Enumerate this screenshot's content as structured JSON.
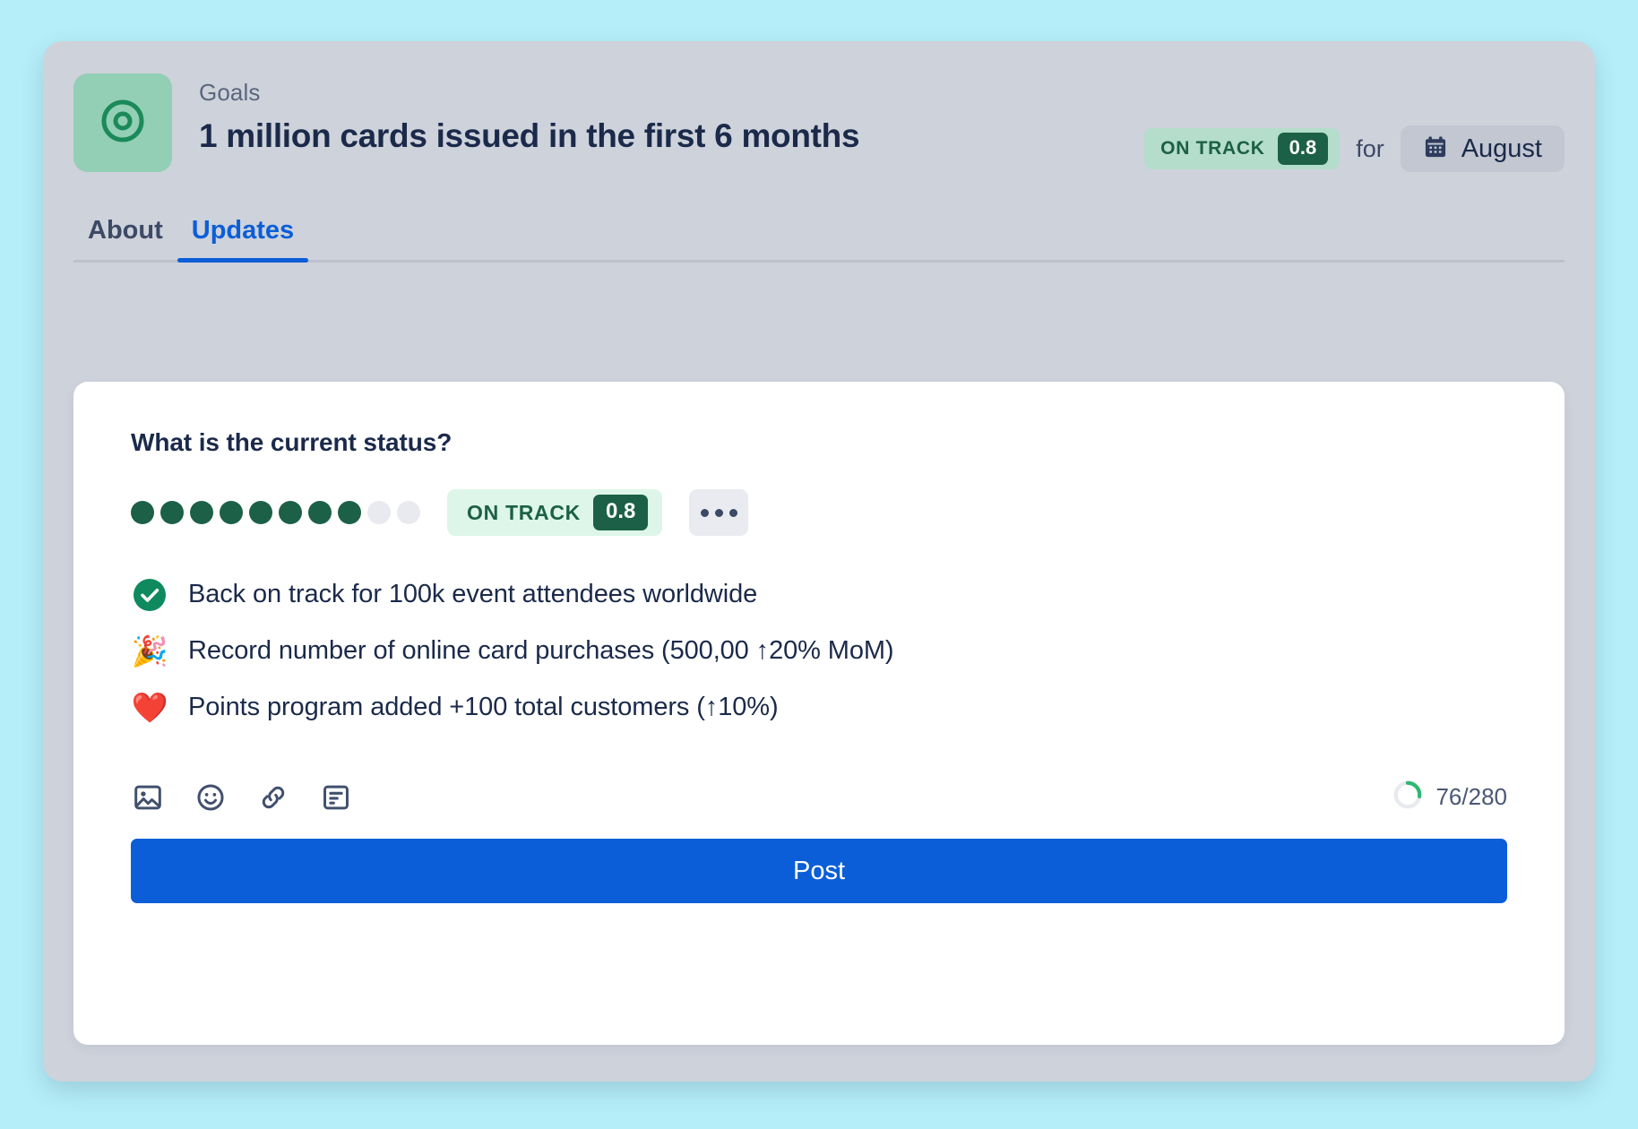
{
  "header": {
    "icon_name": "target-icon",
    "eyebrow": "Goals",
    "title": "1 million cards issued in the first 6 months",
    "status": {
      "label": "ON TRACK",
      "score": "0.8"
    },
    "for_text": "for",
    "month": {
      "icon_name": "calendar-icon",
      "label": "August"
    }
  },
  "tabs": [
    {
      "label": "About",
      "active": false
    },
    {
      "label": "Updates",
      "active": true
    }
  ],
  "composer": {
    "prompt": "What is the current status?",
    "progress_dots": {
      "total": 10,
      "filled": 8
    },
    "status": {
      "label": "ON TRACK",
      "score": "0.8"
    },
    "more_button_label": "...",
    "bullets": [
      {
        "icon": "✔",
        "icon_name": "check-circle-icon",
        "text": "Back on track for 100k event attendees worldwide"
      },
      {
        "icon": "🎉",
        "icon_name": "party-popper-icon",
        "text": "Record number of online card purchases (500,00 ↑20% MoM)"
      },
      {
        "icon": "❤️",
        "icon_name": "heart-icon",
        "text": "Points program added +100 total customers (↑10%)"
      }
    ],
    "tools": [
      {
        "icon_name": "image-icon"
      },
      {
        "icon_name": "emoji-icon"
      },
      {
        "icon_name": "link-icon"
      },
      {
        "icon_name": "document-icon"
      }
    ],
    "counter": {
      "text": "76/280",
      "used": 76,
      "limit": 280
    },
    "post_label": "Post"
  },
  "colors": {
    "page_background": "#b5eef8",
    "panel_background": "#ced2db",
    "card_background": "#ffffff",
    "accent_blue": "#0b5ed7",
    "status_green": "#1c6047",
    "status_green_light": "#b4ddcb",
    "status_green_lighter": "#ddf6e9",
    "tile_green": "#93cfb5",
    "text_dark": "#1b2a4a",
    "text_muted": "#5b677e",
    "progress_green": "#2eb872"
  }
}
